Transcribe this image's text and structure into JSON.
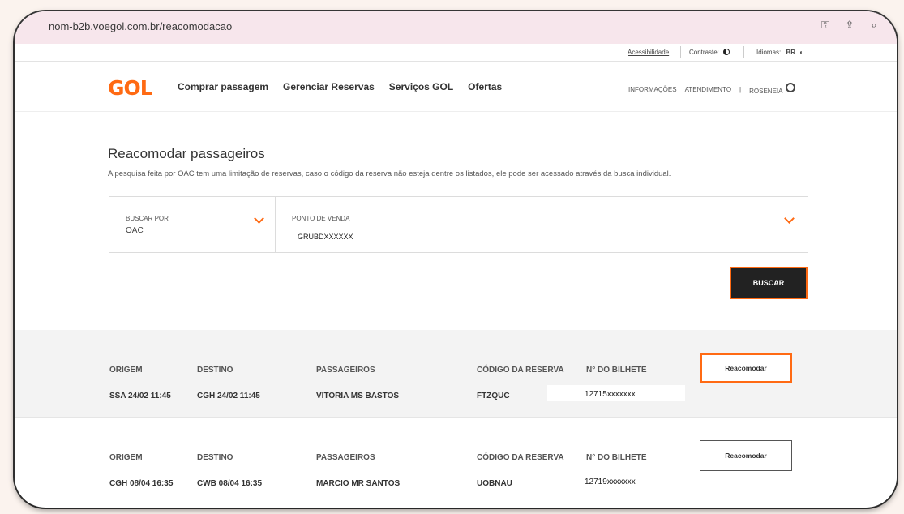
{
  "browser": {
    "url": "nom-b2b.voegol.com.br/reacomodacao",
    "icons": [
      "key-icon",
      "share-icon",
      "zoom-icon"
    ]
  },
  "utility": {
    "accessibility": "Acessibilidade",
    "contrast": "Contraste:",
    "language_label": "Idiomas:",
    "language_value": "BR"
  },
  "nav": {
    "logo": "GOL",
    "menu": [
      "Comprar passagem",
      "Gerenciar Reservas",
      "Serviços GOL",
      "Ofertas"
    ],
    "info": "INFORMAÇÕES",
    "support": "ATENDIMENTO",
    "user": "ROSENEIA"
  },
  "page": {
    "title": "Reacomodar passageiros",
    "subtitle": "A pesquisa feita por OAC tem uma limitação de reservas, caso o código da reserva não esteja dentre os listados, ele pode ser acessado através da busca individual."
  },
  "search": {
    "search_by_label": "BUSCAR POR",
    "search_by_value": "OAC",
    "point_of_sale_label": "PONTO DE VENDA",
    "point_of_sale_value": "GRUBDXXXXXX",
    "button": "BUSCAR"
  },
  "results": [
    {
      "headers": {
        "origin": "ORIGEM",
        "destination": "DESTINO",
        "passengers": "PASSAGEIROS",
        "booking_code": "CÓDIGO DA RESERVA",
        "ticket": "N° DO BILHETE"
      },
      "origin": "SSA 24/02 11:45",
      "destination": "CGH 24/02 11:45",
      "passengers": "VITORIA MS BASTOS",
      "booking_code": "FTZQUC",
      "ticket": "12715xxxxxxx",
      "action": "Reacomodar"
    },
    {
      "headers": {
        "origin": "ORIGEM",
        "destination": "DESTINO",
        "passengers": "PASSAGEIROS",
        "booking_code": "CÓDIGO DA RESERVA",
        "ticket": "N° DO BILHETE"
      },
      "origin": "CGH 08/04 16:35",
      "destination": "CWB 08/04 16:35",
      "passengers": "MARCIO MR SANTOS",
      "booking_code": "UOBNAU",
      "ticket": "12719xxxxxxx",
      "action": "Reacomodar"
    }
  ],
  "colors": {
    "accent": "#ff6a13",
    "dark_button": "#222222",
    "url_bar": "#f7e6ec"
  }
}
